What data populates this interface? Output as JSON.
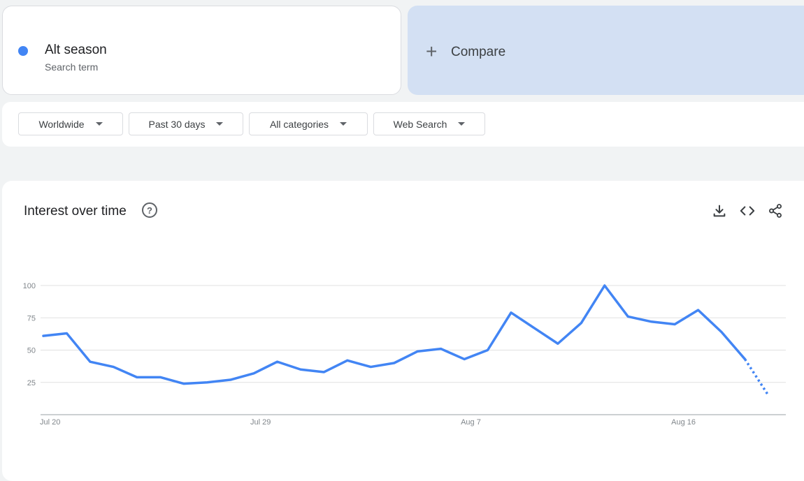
{
  "search_term": {
    "name": "Alt season",
    "subtitle": "Search term",
    "color": "#4285f4"
  },
  "compare": {
    "plus": "+",
    "label": "Compare"
  },
  "filters": [
    {
      "label": "Worldwide"
    },
    {
      "label": "Past 30 days"
    },
    {
      "label": "All categories"
    },
    {
      "label": "Web Search"
    }
  ],
  "chart_section": {
    "title": "Interest over time",
    "help_icon": "help-icon",
    "tools": [
      "download-icon",
      "embed-icon",
      "share-icon"
    ]
  },
  "chart_data": {
    "type": "line",
    "title": "",
    "xlabel": "",
    "ylabel": "",
    "ylim": [
      0,
      100
    ],
    "y_ticks": [
      25,
      50,
      75,
      100
    ],
    "x_tick_labels": [
      {
        "label": "Jul 20",
        "index": 0
      },
      {
        "label": "Jul 29",
        "index": 9
      },
      {
        "label": "Aug 7",
        "index": 18
      },
      {
        "label": "Aug 16",
        "index": 27
      }
    ],
    "grid": true,
    "legend": "none",
    "series": [
      {
        "color": "#4285f4",
        "values": [
          61,
          63,
          41,
          37,
          29,
          29,
          24,
          25,
          27,
          32,
          41,
          35,
          33,
          42,
          37,
          40,
          49,
          51,
          43,
          50,
          79,
          67,
          55,
          71,
          100,
          76,
          72,
          70,
          81,
          64,
          43,
          15
        ],
        "partial_from_index": 30
      }
    ]
  }
}
